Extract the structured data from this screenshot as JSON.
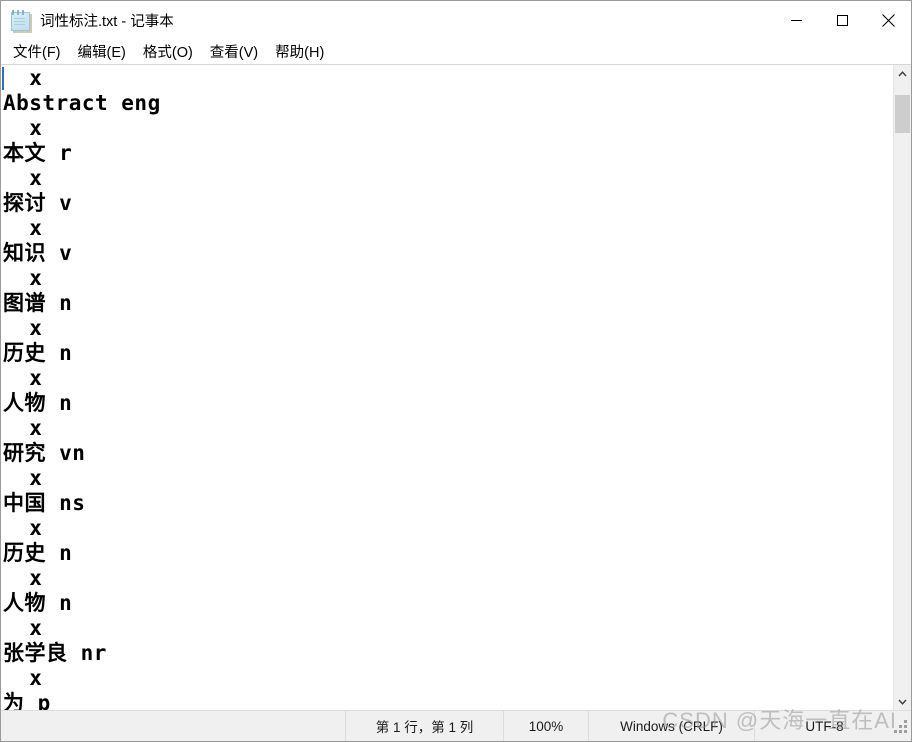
{
  "window": {
    "title": "词性标注.txt - 记事本",
    "icon": "notepad-icon",
    "controls": {
      "minimize": "minimize-icon",
      "maximize": "maximize-icon",
      "close": "close-icon"
    }
  },
  "menubar": {
    "items": [
      {
        "label": "文件(F)"
      },
      {
        "label": "编辑(E)"
      },
      {
        "label": "格式(O)"
      },
      {
        "label": "查看(V)"
      },
      {
        "label": "帮助(H)"
      }
    ]
  },
  "editor": {
    "content": "  x\nAbstract eng\n  x\n本文 r\n  x\n探讨 v\n  x\n知识 v\n  x\n图谱 n\n  x\n历史 n\n  x\n人物 n\n  x\n研究 vn\n  x\n中国 ns\n  x\n历史 n\n  x\n人物 n\n  x\n张学良 nr\n  x\n为 p",
    "lines": [
      "  x",
      "Abstract eng",
      "  x",
      "本文 r",
      "  x",
      "探讨 v",
      "  x",
      "知识 v",
      "  x",
      "图谱 n",
      "  x",
      "历史 n",
      "  x",
      "人物 n",
      "  x",
      "研究 vn",
      "  x",
      "中国 ns",
      "  x",
      "历史 n",
      "  x",
      "人物 n",
      "  x",
      "张学良 nr",
      "  x",
      "为 p"
    ]
  },
  "scrollbar": {
    "up_icon": "chevron-up-icon",
    "down_icon": "chevron-down-icon",
    "thumb": "scrollbar-thumb"
  },
  "statusbar": {
    "position": "第 1 行，第 1 列",
    "zoom": "100%",
    "line_ending": "Windows (CRLF)",
    "encoding": "UTF-8",
    "grip": "resize-grip"
  },
  "watermark": {
    "text": "CSDN @天海一直在AI"
  },
  "colors": {
    "window_bg": "#ffffff",
    "statusbar_bg": "#f0f0f0",
    "border": "#9a9a9a",
    "caret": "#2b6fb5",
    "scrollbar_thumb": "#cdcdcd",
    "watermark": "#969696"
  }
}
